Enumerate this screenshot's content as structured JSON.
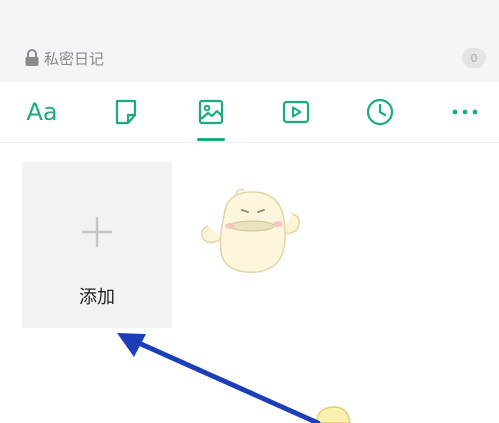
{
  "header": {
    "private_diary_label": "私密日记",
    "private_count": "0",
    "lock_icon": "lock-icon"
  },
  "toolbar": {
    "text_tool_label": "Aa",
    "icons": [
      "text-format",
      "note-icon",
      "image-icon",
      "video-icon",
      "clock-icon",
      "more-icon"
    ],
    "active_tab": "image-icon",
    "accent_color": "#1aad7a"
  },
  "content": {
    "add_label": "添加",
    "add_icon": "plus-icon"
  },
  "annotation": {
    "arrow_color": "#1c3fb8"
  }
}
